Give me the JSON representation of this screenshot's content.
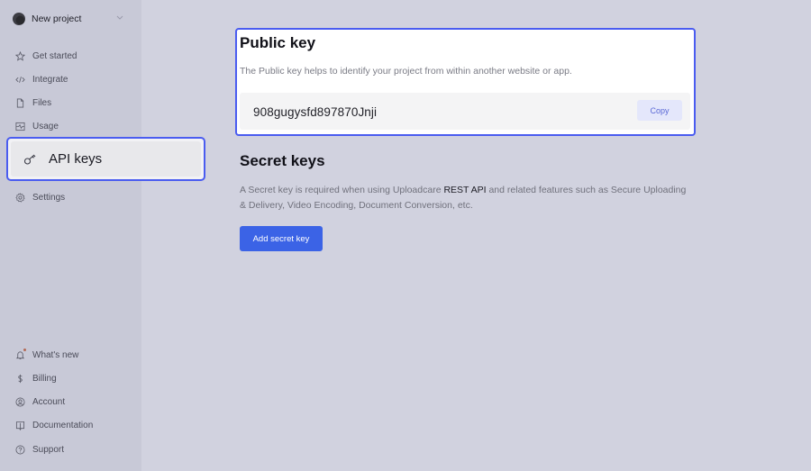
{
  "sidebar": {
    "project": {
      "name": "New project",
      "icon": "project-avatar"
    },
    "top_items": [
      {
        "label": "Get started",
        "icon": "star-icon"
      },
      {
        "label": "Integrate",
        "icon": "code-icon"
      },
      {
        "label": "Files",
        "icon": "file-icon"
      },
      {
        "label": "Usage",
        "icon": "chart-icon"
      },
      {
        "label": "API keys",
        "icon": "key-icon",
        "active": true
      },
      {
        "label": "Settings",
        "icon": "gear-icon"
      }
    ],
    "bottom_items": [
      {
        "label": "What's new",
        "icon": "bell-icon",
        "has_notification": true
      },
      {
        "label": "Billing",
        "icon": "dollar-icon"
      },
      {
        "label": "Account",
        "icon": "user-circle-icon"
      },
      {
        "label": "Documentation",
        "icon": "book-icon"
      },
      {
        "label": "Support",
        "icon": "help-icon"
      }
    ]
  },
  "public_key": {
    "title": "Public key",
    "description": "The Public key helps to identify your project from within another website or app.",
    "value": "908gugysfd897870Jnji",
    "copy_label": "Copy"
  },
  "secret_keys": {
    "title": "Secret keys",
    "description_part1": "A Secret key is required when using Uploadcare ",
    "description_link": "REST API",
    "description_part2": " and related features such as Secure Uploading & Delivery, Video Encoding, Document Conversion, etc.",
    "add_label": "Add secret key"
  },
  "colors": {
    "accent": "#3b63e6",
    "highlight_border": "#4a5cf0",
    "sidebar_bg": "#c8c9d7",
    "main_bg": "#d1d2df"
  }
}
